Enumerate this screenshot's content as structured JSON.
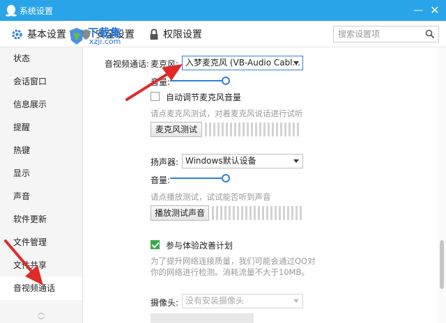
{
  "window": {
    "title": "系统设置",
    "minimize_glyph": "—",
    "close_glyph": "✕",
    "accent_color": "#2aa4e8"
  },
  "tabs": [
    {
      "label": "基本设置",
      "icon": "gear-icon"
    },
    {
      "label": "安全设置",
      "icon": "shield-icon"
    },
    {
      "label": "权限设置",
      "icon": "lock-icon"
    }
  ],
  "search": {
    "placeholder": "搜索设置项",
    "icon": "search-icon"
  },
  "watermark": {
    "main": "下载集",
    "sub": "xzji.com"
  },
  "sidebar": {
    "items": [
      {
        "label": "状态"
      },
      {
        "label": "会话窗口"
      },
      {
        "label": "信息展示"
      },
      {
        "label": "提醒"
      },
      {
        "label": "热键"
      },
      {
        "label": "显示"
      },
      {
        "label": "声音"
      },
      {
        "label": "软件更新"
      },
      {
        "label": "文件管理"
      },
      {
        "label": "文件共享"
      },
      {
        "label": "音视频通话"
      }
    ],
    "active_item": "音视频通话"
  },
  "av": {
    "section_label": "音视频通话:",
    "mic": {
      "label": "麦克风:",
      "selected": "入梦麦克风 (VB-Audio Cabl...",
      "volume_label": "音量:",
      "volume_level": 1.0,
      "auto_adjust_label": "自动调节麦克风音量",
      "auto_adjust_checked": false,
      "hint": "请点麦克风测试，对着麦克风说话进行试听",
      "test_button": "麦克风测试"
    },
    "speaker": {
      "label": "扬声器:",
      "selected": "Windows默认设备",
      "volume_label": "音量:",
      "volume_level": 1.0,
      "hint": "请点播放测试，试试能否听到声音",
      "test_button": "播放测试声音"
    },
    "improve": {
      "label": "参与体验改善计划",
      "checked": true,
      "hint_line1": "为了提升网络连接质量，我们可能会通过QQ对",
      "hint_line2": "你的网络进行检测。消耗流量不大于10MB。"
    },
    "camera": {
      "label": "摄像头:",
      "selected": "没有安装摄像头"
    }
  }
}
